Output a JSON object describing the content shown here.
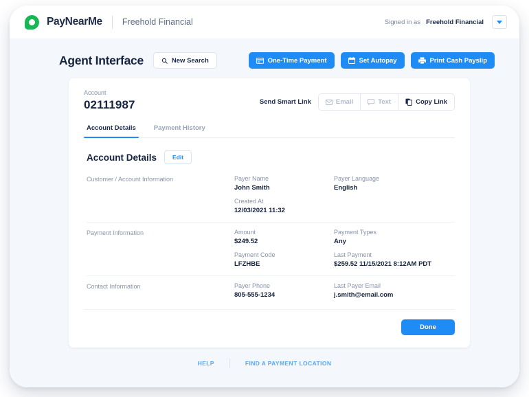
{
  "topbar": {
    "logo_icon": "paynearme-droplet-logo",
    "brand": "PayNearMe",
    "partner": "Freehold Financial",
    "signed_in_label": "Signed in as",
    "signed_in_value": "Freehold Financial",
    "caret_icon": "chevron-down-icon"
  },
  "header": {
    "title": "Agent Interface",
    "new_search": {
      "label": "New Search",
      "icon": "search-icon"
    },
    "actions": [
      {
        "label": "One-Time Payment",
        "icon": "credit-card-icon"
      },
      {
        "label": "Set Autopay",
        "icon": "calendar-icon"
      },
      {
        "label": "Print Cash Payslip",
        "icon": "printer-icon"
      }
    ]
  },
  "account": {
    "label": "Account",
    "number": "02111987",
    "smart_link_label": "Send Smart Link",
    "smart_link_buttons": [
      {
        "label": "Email",
        "icon": "envelope-icon",
        "enabled": false
      },
      {
        "label": "Text",
        "icon": "chat-bubble-icon",
        "enabled": false
      },
      {
        "label": "Copy Link",
        "icon": "copy-icon",
        "enabled": true
      }
    ]
  },
  "tabs": [
    {
      "label": "Account Details",
      "selected": true
    },
    {
      "label": "Payment History",
      "selected": false
    }
  ],
  "section": {
    "title": "Account Details",
    "edit_label": "Edit"
  },
  "details": [
    {
      "category": "Customer / Account Information",
      "col1": [
        {
          "label": "Payer Name",
          "value": "John Smith"
        },
        {
          "label": "Created At",
          "value": "12/03/2021 11:32"
        }
      ],
      "col2": [
        {
          "label": "Payer Language",
          "value": "English"
        }
      ]
    },
    {
      "category": "Payment Information",
      "col1": [
        {
          "label": "Amount",
          "value": "$249.52"
        },
        {
          "label": "Payment Code",
          "value": "LFZHBE"
        }
      ],
      "col2": [
        {
          "label": "Payment Types",
          "value": "Any"
        },
        {
          "label": "Last Payment",
          "value": "$259.52 11/15/2021 8:12AM PDT"
        }
      ]
    },
    {
      "category": "Contact Information",
      "col1": [
        {
          "label": "Payer Phone",
          "value": "805-555-1234"
        }
      ],
      "col2": [
        {
          "label": "Last Payer Email",
          "value": "j.smith@email.com"
        }
      ]
    }
  ],
  "footer_card": {
    "done_label": "Done"
  },
  "footer_links": [
    {
      "label": "HELP"
    },
    {
      "label": "FIND A PAYMENT LOCATION"
    }
  ],
  "colors": {
    "accent_blue": "#1f8cf5",
    "brand_green": "#18b755",
    "dark_navy": "#16243f",
    "muted": "#8793a9",
    "page_bg": "#f4f7fb"
  }
}
